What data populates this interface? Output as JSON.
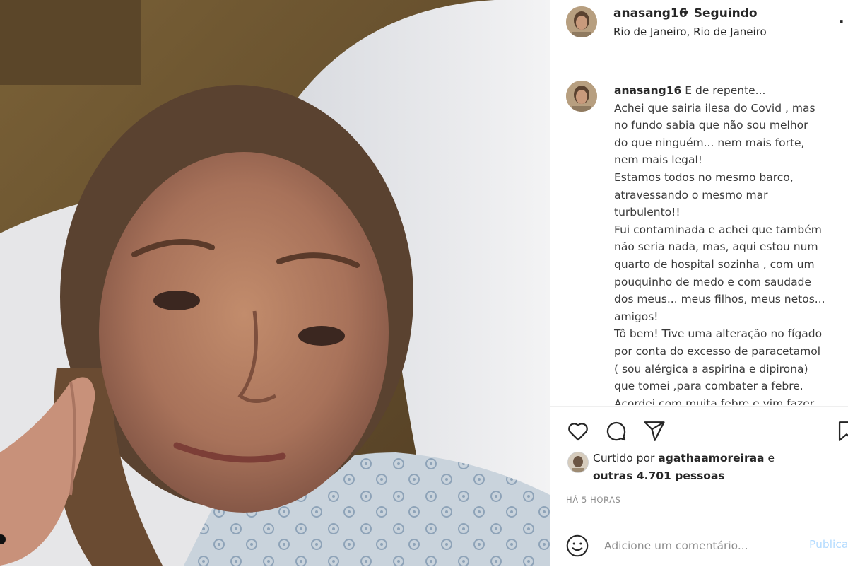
{
  "post": {
    "username": "anasang16",
    "follow_status": "• Seguindo",
    "location": "Rio de Janeiro, Rio de Janeiro",
    "more_label": "·",
    "photo_alt": "selfie"
  },
  "caption": {
    "username": "anasang16",
    "lines": [
      "E de repente...",
      "Achei que sairia ilesa do Covid , mas",
      "no fundo sabia que não sou melhor",
      "do que ninguém... nem mais forte,",
      "nem mais legal!",
      "Estamos todos no mesmo barco,",
      "atravessando o mesmo mar",
      "turbulento!!",
      "Fui contaminada e achei que também",
      "não seria nada, mas, aqui estou num",
      "quarto de hospital sozinha , com um",
      "pouquinho de medo e com saudade",
      "dos meus... meus filhos, meus netos...",
      "amigos!",
      "Tô bem! Tive uma alteração no fígado",
      "por conta do excesso de paracetamol",
      "( sou alérgica a aspirina e dipirona)",
      "que tomei ,para combater a febre.",
      "Acordei com muita febre e vim fazer"
    ]
  },
  "actions": {
    "like_icon": "heart-icon",
    "comment_icon": "comment-icon",
    "share_icon": "share-icon",
    "save_icon": "bookmark-icon"
  },
  "likes": {
    "prefix": "Curtido por",
    "user": "agathaamoreiraa",
    "conj": "e",
    "others_count": "outras 4.701 pessoas"
  },
  "time_ago": "HÁ 5 HORAS",
  "comment": {
    "placeholder": "Adicione um comentário...",
    "publish_label": "Publicar"
  },
  "colors": {
    "text": "#262626",
    "secondary": "#8e8e8e",
    "publish_disabled": "#b3dbff",
    "border": "#efefef"
  }
}
